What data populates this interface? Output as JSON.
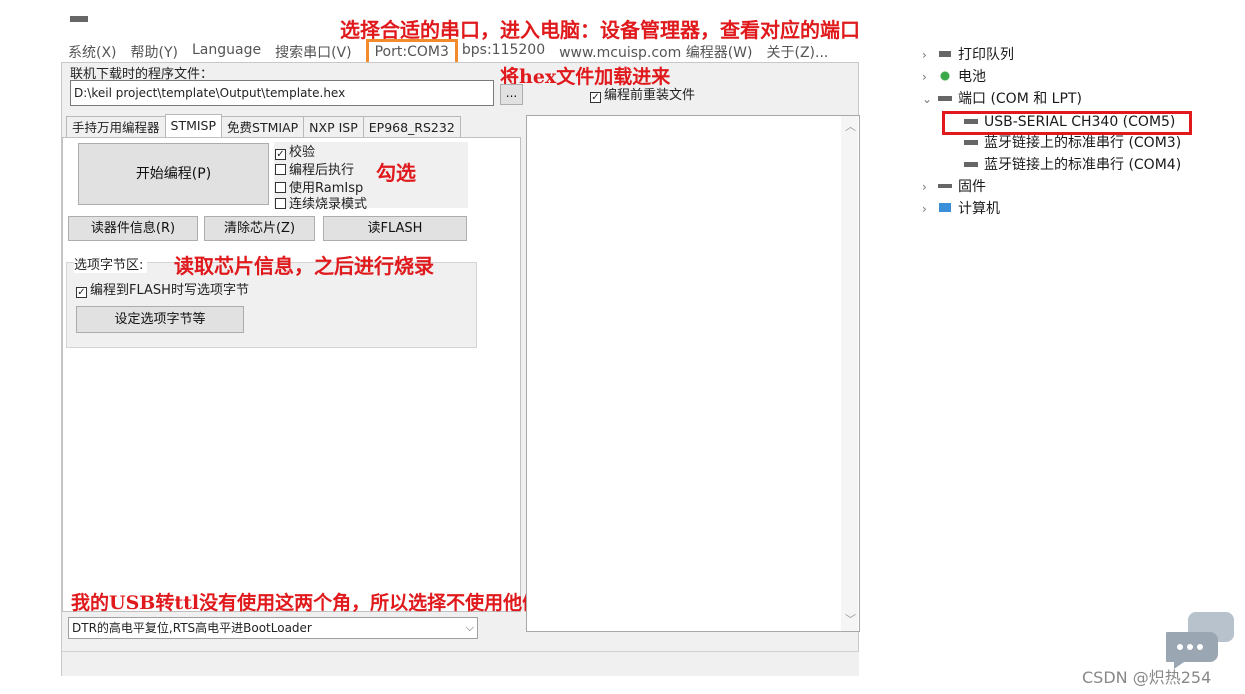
{
  "annotations": {
    "top": "选择合适的串口，进入电脑：设备管理器，查看对应的端口",
    "load_hex": "将hex文件加载进来",
    "check": "勾选",
    "read_info": "读取芯片信息，之后进行烧录",
    "dtr_note": "我的USB转ttl没有使用这两个角，所以选择不使用他们"
  },
  "menubar": {
    "items": [
      "系统(X)",
      "帮助(Y)",
      "Language",
      "搜索串口(V)"
    ],
    "port": "Port:COM3",
    "bps": "bps:115200",
    "site": "www.mcuisp.com",
    "programmer": "编程器(W)",
    "about": "关于(Z)..."
  },
  "file_section": {
    "label": "联机下载时的程序文件：",
    "path": "D:\\keil project\\template\\Output\\template.hex",
    "browse": "...",
    "reload_label": "编程前重装文件",
    "reload_checked": true
  },
  "tabs": [
    "手持万用编程器",
    "STMISP",
    "免费STMIAP",
    "NXP ISP",
    "EP968_RS232"
  ],
  "active_tab": 1,
  "buttons": {
    "start": "开始编程(P)",
    "read_info": "读器件信息(R)",
    "erase": "清除芯片(Z)",
    "read_flash": "读FLASH",
    "option_settings": "设定选项字节等"
  },
  "options": [
    {
      "label": "校验",
      "checked": true
    },
    {
      "label": "编程后执行",
      "checked": false
    },
    {
      "label": "使用RamIsp",
      "checked": false
    },
    {
      "label": "连续烧录模式",
      "checked": false
    }
  ],
  "option_bytes": {
    "title": "选项字节区:",
    "write_label": "编程到FLASH时写选项字节",
    "write_checked": true
  },
  "dtr_select": {
    "value": "DTR的高电平复位,RTS高电平进BootLoader"
  },
  "device_tree": {
    "print_queue": "打印队列",
    "battery": "电池",
    "ports": "端口 (COM 和 LPT)",
    "ch340": "USB-SERIAL CH340 (COM5)",
    "bt3": "蓝牙链接上的标准串行 (COM3)",
    "bt4": "蓝牙链接上的标准串行 (COM4)",
    "firmware": "固件",
    "computer": "计算机"
  },
  "watermark": "CSDN @炽热254",
  "colors": {
    "annotation": "#e0191c",
    "port_highlight": "#f18b2c",
    "com5_highlight": "#e0191c"
  }
}
